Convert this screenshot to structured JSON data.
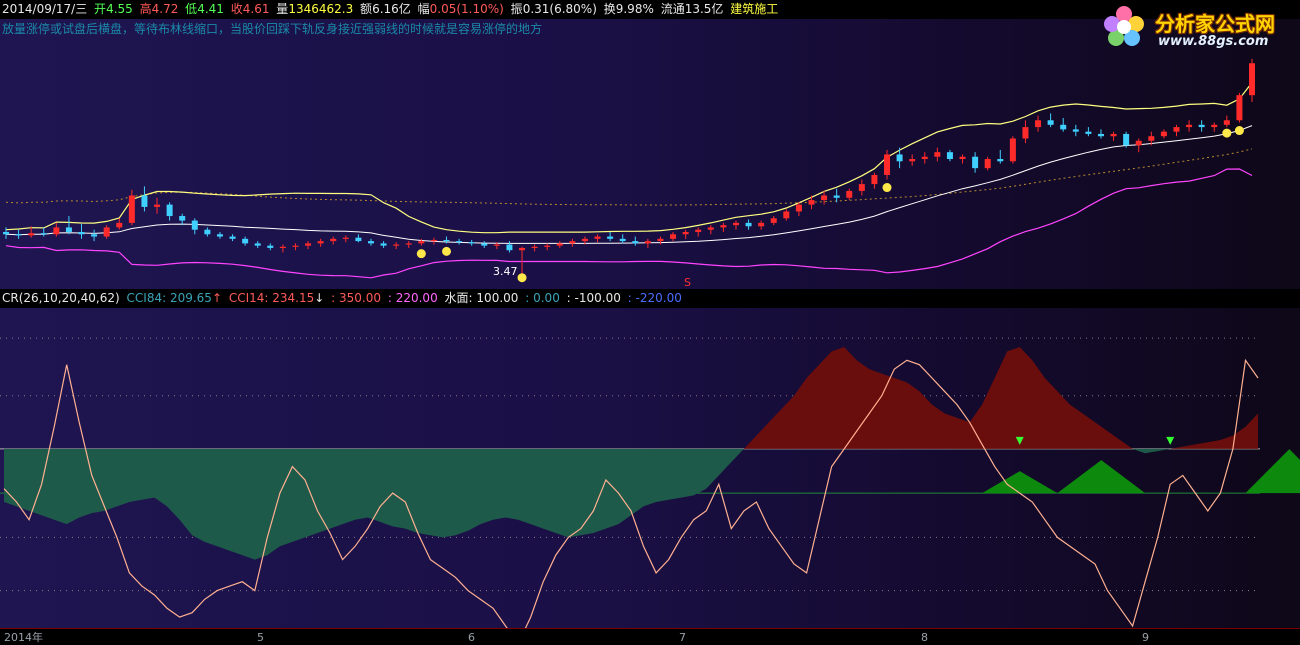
{
  "header": {
    "date": "2014/09/17/三",
    "open_label": "开",
    "open": "4.55",
    "high_label": "高",
    "high": "4.72",
    "low_label": "低",
    "low": "4.41",
    "close_label": "收",
    "close": "4.61",
    "vol_label": "量",
    "volume": "1346462.3",
    "amt_label": "额",
    "amount": "6.16亿",
    "chg_label": "幅",
    "change": "0.05(1.10%)",
    "amp_label": "振",
    "amplitude": "0.31(6.80%)",
    "turn_label": "换",
    "turnover": "9.98%",
    "float_label": "流通",
    "float": "13.5亿",
    "sector": "建筑施工"
  },
  "hint": "放量涨停或试盘后横盘，等待布林线缩口，当股价回踩下轨反身接近强弱线的时候就是容易涨停的地方",
  "logo": {
    "title": "分析家公式网",
    "url": "www.88gs.com"
  },
  "price_annotations": {
    "low_value": "3.47",
    "s_marker": "S"
  },
  "indicator_bar": {
    "name": "CR(26,10,20,40,62)",
    "cci84_label": "CCI84:",
    "cci84": "209.65",
    "cci14_label": "CCI14:",
    "cci14": "234.15",
    "l350": ": 350.00",
    "l220": ": 220.00",
    "water_label": "水面:",
    "water": "100.00",
    "l0": ": 0.00",
    "lm100": ": -100.00",
    "lm220": ": -220.00"
  },
  "time_axis": {
    "labels": [
      "2014年",
      "5",
      "6",
      "7",
      "8",
      "9"
    ]
  },
  "colors": {
    "bg_left": "#1f1550",
    "bg_right": "#0e0818",
    "up_candle": "#ff2a2a",
    "down_candle": "#3fd0ff",
    "boll_mid": "#ffff66",
    "boll_up": "#ffff80",
    "boll_low": "#ff44ff",
    "cci84_fill_pos": "#6a0d0d",
    "cci84_fill_neg": "#1e5a4a",
    "cci14_line": "#ffb090",
    "signal_green": "#0d8a0d"
  },
  "chart_data": [
    {
      "type": "candlestick",
      "title": "",
      "x_labels": [
        "2014年",
        "5",
        "6",
        "7",
        "8",
        "9"
      ],
      "ohlc": [
        [
          3.88,
          3.92,
          3.82,
          3.86
        ],
        [
          3.86,
          3.9,
          3.82,
          3.85
        ],
        [
          3.85,
          3.93,
          3.83,
          3.87
        ],
        [
          3.87,
          3.92,
          3.84,
          3.86
        ],
        [
          3.86,
          3.96,
          3.84,
          3.92
        ],
        [
          3.92,
          4.02,
          3.86,
          3.88
        ],
        [
          3.88,
          3.95,
          3.82,
          3.86
        ],
        [
          3.86,
          3.9,
          3.8,
          3.84
        ],
        [
          3.84,
          3.94,
          3.82,
          3.92
        ],
        [
          3.92,
          4.0,
          3.9,
          3.96
        ],
        [
          3.96,
          4.25,
          3.94,
          4.2
        ],
        [
          4.2,
          4.28,
          4.06,
          4.1
        ],
        [
          4.1,
          4.18,
          4.04,
          4.12
        ],
        [
          4.12,
          4.14,
          3.98,
          4.02
        ],
        [
          4.02,
          4.04,
          3.94,
          3.98
        ],
        [
          3.98,
          4.0,
          3.86,
          3.9
        ],
        [
          3.9,
          3.92,
          3.84,
          3.86
        ],
        [
          3.86,
          3.88,
          3.82,
          3.84
        ],
        [
          3.84,
          3.86,
          3.8,
          3.82
        ],
        [
          3.82,
          3.84,
          3.76,
          3.78
        ],
        [
          3.78,
          3.8,
          3.74,
          3.76
        ],
        [
          3.76,
          3.78,
          3.72,
          3.74
        ],
        [
          3.74,
          3.77,
          3.7,
          3.75
        ],
        [
          3.75,
          3.78,
          3.72,
          3.76
        ],
        [
          3.76,
          3.8,
          3.73,
          3.78
        ],
        [
          3.78,
          3.82,
          3.75,
          3.8
        ],
        [
          3.8,
          3.84,
          3.77,
          3.82
        ],
        [
          3.82,
          3.85,
          3.79,
          3.83
        ],
        [
          3.83,
          3.86,
          3.79,
          3.8
        ],
        [
          3.8,
          3.82,
          3.76,
          3.78
        ],
        [
          3.78,
          3.8,
          3.74,
          3.76
        ],
        [
          3.76,
          3.79,
          3.73,
          3.77
        ],
        [
          3.77,
          3.8,
          3.74,
          3.78
        ],
        [
          3.78,
          3.82,
          3.76,
          3.8
        ],
        [
          3.8,
          3.83,
          3.77,
          3.81
        ],
        [
          3.81,
          3.84,
          3.78,
          3.8
        ],
        [
          3.8,
          3.82,
          3.77,
          3.79
        ],
        [
          3.79,
          3.81,
          3.76,
          3.78
        ],
        [
          3.78,
          3.8,
          3.74,
          3.76
        ],
        [
          3.76,
          3.79,
          3.73,
          3.77
        ],
        [
          3.77,
          3.8,
          3.7,
          3.72
        ],
        [
          3.72,
          3.75,
          3.47,
          3.74
        ],
        [
          3.74,
          3.77,
          3.71,
          3.75
        ],
        [
          3.75,
          3.78,
          3.72,
          3.76
        ],
        [
          3.76,
          3.8,
          3.74,
          3.78
        ],
        [
          3.78,
          3.82,
          3.75,
          3.8
        ],
        [
          3.8,
          3.84,
          3.77,
          3.82
        ],
        [
          3.82,
          3.86,
          3.79,
          3.84
        ],
        [
          3.84,
          3.88,
          3.8,
          3.82
        ],
        [
          3.82,
          3.86,
          3.78,
          3.8
        ],
        [
          3.8,
          3.84,
          3.76,
          3.78
        ],
        [
          3.78,
          3.82,
          3.74,
          3.8
        ],
        [
          3.8,
          3.84,
          3.77,
          3.82
        ],
        [
          3.82,
          3.88,
          3.8,
          3.86
        ],
        [
          3.86,
          3.9,
          3.82,
          3.88
        ],
        [
          3.88,
          3.92,
          3.84,
          3.9
        ],
        [
          3.9,
          3.94,
          3.86,
          3.92
        ],
        [
          3.92,
          3.96,
          3.88,
          3.94
        ],
        [
          3.94,
          3.98,
          3.9,
          3.96
        ],
        [
          3.96,
          3.99,
          3.9,
          3.93
        ],
        [
          3.93,
          3.98,
          3.9,
          3.96
        ],
        [
          3.96,
          4.02,
          3.94,
          4.0
        ],
        [
          4.0,
          4.08,
          3.98,
          4.06
        ],
        [
          4.06,
          4.14,
          4.02,
          4.12
        ],
        [
          4.12,
          4.2,
          4.08,
          4.16
        ],
        [
          4.16,
          4.24,
          4.12,
          4.2
        ],
        [
          4.2,
          4.26,
          4.14,
          4.18
        ],
        [
          4.18,
          4.26,
          4.16,
          4.24
        ],
        [
          4.24,
          4.34,
          4.2,
          4.3
        ],
        [
          4.3,
          4.4,
          4.26,
          4.38
        ],
        [
          4.38,
          4.6,
          4.34,
          4.56
        ],
        [
          4.56,
          4.62,
          4.44,
          4.5
        ],
        [
          4.5,
          4.56,
          4.46,
          4.52
        ],
        [
          4.52,
          4.58,
          4.48,
          4.54
        ],
        [
          4.54,
          4.62,
          4.5,
          4.58
        ],
        [
          4.58,
          4.6,
          4.5,
          4.52
        ],
        [
          4.52,
          4.56,
          4.48,
          4.54
        ],
        [
          4.54,
          4.58,
          4.4,
          4.44
        ],
        [
          4.44,
          4.54,
          4.42,
          4.52
        ],
        [
          4.52,
          4.6,
          4.48,
          4.5
        ],
        [
          4.5,
          4.72,
          4.48,
          4.7
        ],
        [
          4.7,
          4.86,
          4.66,
          4.8
        ],
        [
          4.8,
          4.9,
          4.76,
          4.86
        ],
        [
          4.86,
          4.92,
          4.8,
          4.82
        ],
        [
          4.82,
          4.88,
          4.76,
          4.78
        ],
        [
          4.78,
          4.82,
          4.72,
          4.76
        ],
        [
          4.76,
          4.8,
          4.72,
          4.74
        ],
        [
          4.74,
          4.78,
          4.7,
          4.72
        ],
        [
          4.72,
          4.76,
          4.68,
          4.74
        ],
        [
          4.74,
          4.76,
          4.62,
          4.64
        ],
        [
          4.64,
          4.7,
          4.58,
          4.68
        ],
        [
          4.68,
          4.76,
          4.64,
          4.72
        ],
        [
          4.72,
          4.78,
          4.7,
          4.76
        ],
        [
          4.76,
          4.82,
          4.72,
          4.8
        ],
        [
          4.8,
          4.86,
          4.76,
          4.82
        ],
        [
          4.82,
          4.86,
          4.76,
          4.8
        ],
        [
          4.8,
          4.84,
          4.76,
          4.82
        ],
        [
          4.82,
          4.9,
          4.8,
          4.86
        ],
        [
          4.86,
          5.1,
          4.84,
          5.08
        ],
        [
          5.08,
          5.4,
          5.02,
          5.36
        ]
      ],
      "bollinger": {
        "lines": [
          "upper",
          "middle",
          "lower"
        ]
      },
      "long_ma": "dotted"
    },
    {
      "type": "line",
      "title": "CR(26,10,20,40,62)",
      "ylim": [
        -300,
        400
      ],
      "reference_lines": [
        350,
        220,
        100,
        0,
        -100,
        -220
      ],
      "series": [
        {
          "name": "CCI84",
          "style": "area",
          "values": [
            -20,
            -30,
            -40,
            -50,
            -60,
            -70,
            -55,
            -45,
            -40,
            -30,
            -20,
            -15,
            -10,
            -30,
            -60,
            -95,
            -110,
            -120,
            -130,
            -140,
            -150,
            -140,
            -120,
            -110,
            -100,
            -90,
            -80,
            -70,
            -60,
            -55,
            -65,
            -75,
            -80,
            -90,
            -95,
            -100,
            -95,
            -85,
            -70,
            -60,
            -55,
            -60,
            -70,
            -80,
            -90,
            -100,
            -95,
            -90,
            -80,
            -70,
            -50,
            -30,
            -20,
            -15,
            -10,
            -5,
            10,
            40,
            70,
            100,
            130,
            160,
            190,
            220,
            260,
            290,
            320,
            330,
            300,
            280,
            270,
            260,
            250,
            230,
            200,
            180,
            170,
            160,
            200,
            260,
            320,
            330,
            300,
            260,
            230,
            200,
            180,
            160,
            140,
            120,
            100,
            90,
            95,
            100,
            105,
            110,
            115,
            120,
            130,
            150,
            180
          ]
        },
        {
          "name": "CCI14",
          "style": "line",
          "values": [
            10,
            -20,
            -60,
            20,
            150,
            290,
            160,
            40,
            -30,
            -100,
            -180,
            -210,
            -230,
            -260,
            -280,
            -270,
            -240,
            -220,
            -210,
            -200,
            -220,
            -100,
            0,
            60,
            30,
            -40,
            -90,
            -150,
            -120,
            -80,
            -30,
            0,
            -20,
            -90,
            -150,
            -170,
            -190,
            -220,
            -240,
            -260,
            -300,
            -340,
            -280,
            -200,
            -140,
            -100,
            -80,
            -40,
            30,
            0,
            -40,
            -120,
            -180,
            -150,
            -100,
            -60,
            -40,
            20,
            -80,
            -40,
            -20,
            -80,
            -120,
            -160,
            -180,
            -60,
            60,
            100,
            140,
            180,
            220,
            280,
            300,
            290,
            260,
            230,
            200,
            160,
            110,
            60,
            20,
            0,
            -20,
            -60,
            -100,
            -120,
            -140,
            -160,
            -220,
            -260,
            -300,
            -200,
            -100,
            20,
            40,
            0,
            -40,
            0,
            100,
            300,
            260
          ]
        }
      ]
    }
  ]
}
